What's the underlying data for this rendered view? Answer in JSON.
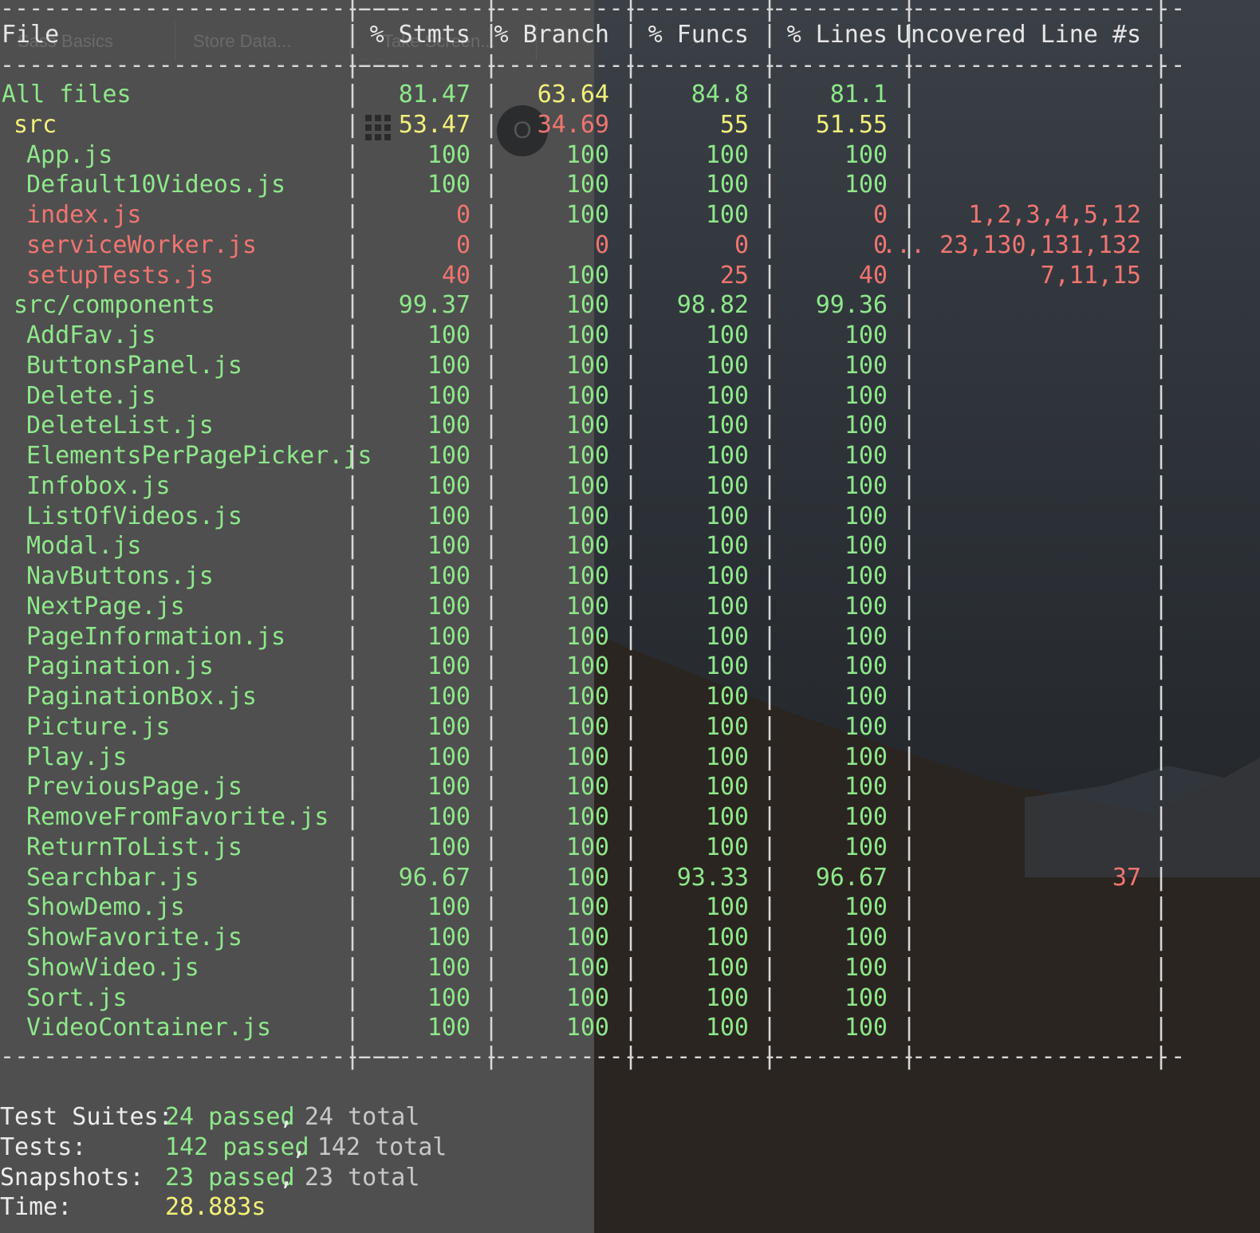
{
  "headers": [
    "File",
    "% Stmts",
    "% Branch",
    "% Funcs",
    "% Lines",
    "Uncovered Line #s"
  ],
  "divider": {
    "file": "----------------------------",
    "num": "----------",
    "unc": "-------------------"
  },
  "ghost_tabs": [
    "Sass Basics",
    "Store Data...",
    "Take Screen..."
  ],
  "ghost_circle_label": "O",
  "rows": [
    {
      "file": "All files",
      "indent": 0,
      "stmts": "81.47",
      "branch": "63.64",
      "funcs": "84.8",
      "lines": "81.1",
      "uncovered": "",
      "file_color": "green",
      "colors": [
        "green",
        "yellow",
        "green",
        "green"
      ]
    },
    {
      "file": "src",
      "indent": 1,
      "stmts": "53.47",
      "branch": "34.69",
      "funcs": "55",
      "lines": "51.55",
      "uncovered": "",
      "file_color": "yellow",
      "colors": [
        "yellow",
        "red",
        "yellow",
        "yellow"
      ]
    },
    {
      "file": "App.js",
      "indent": 2,
      "stmts": "100",
      "branch": "100",
      "funcs": "100",
      "lines": "100",
      "uncovered": "",
      "file_color": "green",
      "colors": [
        "green",
        "green",
        "green",
        "green"
      ]
    },
    {
      "file": "Default10Videos.js",
      "indent": 2,
      "stmts": "100",
      "branch": "100",
      "funcs": "100",
      "lines": "100",
      "uncovered": "",
      "file_color": "green",
      "colors": [
        "green",
        "green",
        "green",
        "green"
      ]
    },
    {
      "file": "index.js",
      "indent": 2,
      "stmts": "0",
      "branch": "100",
      "funcs": "100",
      "lines": "0",
      "uncovered": "1,2,3,4,5,12",
      "file_color": "red",
      "colors": [
        "red",
        "green",
        "green",
        "red"
      ]
    },
    {
      "file": "serviceWorker.js",
      "indent": 2,
      "stmts": "0",
      "branch": "0",
      "funcs": "0",
      "lines": "0",
      "uncovered": "... 23,130,131,132",
      "file_color": "red",
      "colors": [
        "red",
        "red",
        "red",
        "red"
      ]
    },
    {
      "file": "setupTests.js",
      "indent": 2,
      "stmts": "40",
      "branch": "100",
      "funcs": "25",
      "lines": "40",
      "uncovered": "7,11,15",
      "file_color": "red",
      "colors": [
        "red",
        "green",
        "red",
        "red"
      ]
    },
    {
      "file": "src/components",
      "indent": 1,
      "stmts": "99.37",
      "branch": "100",
      "funcs": "98.82",
      "lines": "99.36",
      "uncovered": "",
      "file_color": "green",
      "colors": [
        "green",
        "green",
        "green",
        "green"
      ]
    },
    {
      "file": "AddFav.js",
      "indent": 2,
      "stmts": "100",
      "branch": "100",
      "funcs": "100",
      "lines": "100",
      "uncovered": "",
      "file_color": "green",
      "colors": [
        "green",
        "green",
        "green",
        "green"
      ]
    },
    {
      "file": "ButtonsPanel.js",
      "indent": 2,
      "stmts": "100",
      "branch": "100",
      "funcs": "100",
      "lines": "100",
      "uncovered": "",
      "file_color": "green",
      "colors": [
        "green",
        "green",
        "green",
        "green"
      ]
    },
    {
      "file": "Delete.js",
      "indent": 2,
      "stmts": "100",
      "branch": "100",
      "funcs": "100",
      "lines": "100",
      "uncovered": "",
      "file_color": "green",
      "colors": [
        "green",
        "green",
        "green",
        "green"
      ]
    },
    {
      "file": "DeleteList.js",
      "indent": 2,
      "stmts": "100",
      "branch": "100",
      "funcs": "100",
      "lines": "100",
      "uncovered": "",
      "file_color": "green",
      "colors": [
        "green",
        "green",
        "green",
        "green"
      ]
    },
    {
      "file": "ElementsPerPagePicker.js",
      "indent": 2,
      "stmts": "100",
      "branch": "100",
      "funcs": "100",
      "lines": "100",
      "uncovered": "",
      "file_color": "green",
      "colors": [
        "green",
        "green",
        "green",
        "green"
      ]
    },
    {
      "file": "Infobox.js",
      "indent": 2,
      "stmts": "100",
      "branch": "100",
      "funcs": "100",
      "lines": "100",
      "uncovered": "",
      "file_color": "green",
      "colors": [
        "green",
        "green",
        "green",
        "green"
      ]
    },
    {
      "file": "ListOfVideos.js",
      "indent": 2,
      "stmts": "100",
      "branch": "100",
      "funcs": "100",
      "lines": "100",
      "uncovered": "",
      "file_color": "green",
      "colors": [
        "green",
        "green",
        "green",
        "green"
      ]
    },
    {
      "file": "Modal.js",
      "indent": 2,
      "stmts": "100",
      "branch": "100",
      "funcs": "100",
      "lines": "100",
      "uncovered": "",
      "file_color": "green",
      "colors": [
        "green",
        "green",
        "green",
        "green"
      ]
    },
    {
      "file": "NavButtons.js",
      "indent": 2,
      "stmts": "100",
      "branch": "100",
      "funcs": "100",
      "lines": "100",
      "uncovered": "",
      "file_color": "green",
      "colors": [
        "green",
        "green",
        "green",
        "green"
      ]
    },
    {
      "file": "NextPage.js",
      "indent": 2,
      "stmts": "100",
      "branch": "100",
      "funcs": "100",
      "lines": "100",
      "uncovered": "",
      "file_color": "green",
      "colors": [
        "green",
        "green",
        "green",
        "green"
      ]
    },
    {
      "file": "PageInformation.js",
      "indent": 2,
      "stmts": "100",
      "branch": "100",
      "funcs": "100",
      "lines": "100",
      "uncovered": "",
      "file_color": "green",
      "colors": [
        "green",
        "green",
        "green",
        "green"
      ]
    },
    {
      "file": "Pagination.js",
      "indent": 2,
      "stmts": "100",
      "branch": "100",
      "funcs": "100",
      "lines": "100",
      "uncovered": "",
      "file_color": "green",
      "colors": [
        "green",
        "green",
        "green",
        "green"
      ]
    },
    {
      "file": "PaginationBox.js",
      "indent": 2,
      "stmts": "100",
      "branch": "100",
      "funcs": "100",
      "lines": "100",
      "uncovered": "",
      "file_color": "green",
      "colors": [
        "green",
        "green",
        "green",
        "green"
      ]
    },
    {
      "file": "Picture.js",
      "indent": 2,
      "stmts": "100",
      "branch": "100",
      "funcs": "100",
      "lines": "100",
      "uncovered": "",
      "file_color": "green",
      "colors": [
        "green",
        "green",
        "green",
        "green"
      ]
    },
    {
      "file": "Play.js",
      "indent": 2,
      "stmts": "100",
      "branch": "100",
      "funcs": "100",
      "lines": "100",
      "uncovered": "",
      "file_color": "green",
      "colors": [
        "green",
        "green",
        "green",
        "green"
      ]
    },
    {
      "file": "PreviousPage.js",
      "indent": 2,
      "stmts": "100",
      "branch": "100",
      "funcs": "100",
      "lines": "100",
      "uncovered": "",
      "file_color": "green",
      "colors": [
        "green",
        "green",
        "green",
        "green"
      ]
    },
    {
      "file": "RemoveFromFavorite.js",
      "indent": 2,
      "stmts": "100",
      "branch": "100",
      "funcs": "100",
      "lines": "100",
      "uncovered": "",
      "file_color": "green",
      "colors": [
        "green",
        "green",
        "green",
        "green"
      ]
    },
    {
      "file": "ReturnToList.js",
      "indent": 2,
      "stmts": "100",
      "branch": "100",
      "funcs": "100",
      "lines": "100",
      "uncovered": "",
      "file_color": "green",
      "colors": [
        "green",
        "green",
        "green",
        "green"
      ]
    },
    {
      "file": "Searchbar.js",
      "indent": 2,
      "stmts": "96.67",
      "branch": "100",
      "funcs": "93.33",
      "lines": "96.67",
      "uncovered": "37",
      "file_color": "green",
      "colors": [
        "green",
        "green",
        "green",
        "green"
      ]
    },
    {
      "file": "ShowDemo.js",
      "indent": 2,
      "stmts": "100",
      "branch": "100",
      "funcs": "100",
      "lines": "100",
      "uncovered": "",
      "file_color": "green",
      "colors": [
        "green",
        "green",
        "green",
        "green"
      ]
    },
    {
      "file": "ShowFavorite.js",
      "indent": 2,
      "stmts": "100",
      "branch": "100",
      "funcs": "100",
      "lines": "100",
      "uncovered": "",
      "file_color": "green",
      "colors": [
        "green",
        "green",
        "green",
        "green"
      ]
    },
    {
      "file": "ShowVideo.js",
      "indent": 2,
      "stmts": "100",
      "branch": "100",
      "funcs": "100",
      "lines": "100",
      "uncovered": "",
      "file_color": "green",
      "colors": [
        "green",
        "green",
        "green",
        "green"
      ]
    },
    {
      "file": "Sort.js",
      "indent": 2,
      "stmts": "100",
      "branch": "100",
      "funcs": "100",
      "lines": "100",
      "uncovered": "",
      "file_color": "green",
      "colors": [
        "green",
        "green",
        "green",
        "green"
      ]
    },
    {
      "file": "VideoContainer.js",
      "indent": 2,
      "stmts": "100",
      "branch": "100",
      "funcs": "100",
      "lines": "100",
      "uncovered": "",
      "file_color": "green",
      "colors": [
        "green",
        "green",
        "green",
        "green"
      ]
    }
  ],
  "summary": [
    {
      "label": "Test Suites:",
      "passed": "24 passed",
      "sep": ",",
      "total": "24 total"
    },
    {
      "label": "Tests:",
      "passed": "142 passed",
      "sep": ",",
      "total": "142 total"
    },
    {
      "label": "Snapshots:",
      "passed": "23 passed",
      "sep": ",",
      "total": "23 total"
    },
    {
      "label": "Time:",
      "passed": "28.883s",
      "sep": "",
      "total": ""
    }
  ],
  "colors": {
    "green": "#8ee88a",
    "yellow": "#f2f07a",
    "red": "#f07570",
    "text": "#ececec",
    "divider": "#d8d8d8",
    "panel": "#4f4f4f"
  }
}
